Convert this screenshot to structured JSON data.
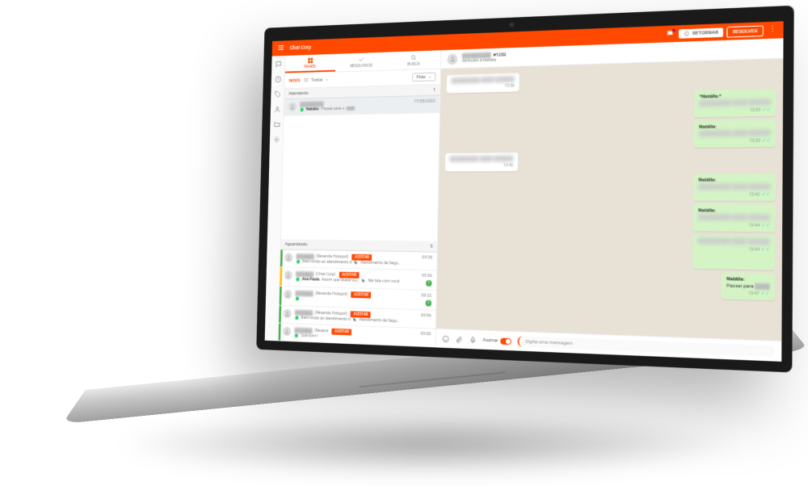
{
  "colors": {
    "accent": "#ff4800",
    "bubble_out": "#d4f4c6",
    "chat_bg": "#e8e1d6"
  },
  "topbar": {
    "title": "Chat Corp",
    "retornar": "RETORNAR",
    "resolver": "RESOLVER"
  },
  "tabs": {
    "inbox": "PAINEL",
    "resolved": "RESOLVIDOS",
    "search": "BUSCA"
  },
  "filters": {
    "novo": "NOVO",
    "todos": "Todos",
    "filas": "Filas"
  },
  "sections": {
    "atendendo": "Atendendo",
    "aguardando": "Aguardando"
  },
  "attending": {
    "count": "1",
    "item": {
      "sender": "Natália:",
      "preview": "Passei para o",
      "time": "17/05/2022"
    }
  },
  "waiting": {
    "count": "5",
    "accept": "ACEITAR",
    "items": [
      {
        "channel": "(Revenda Hotspot)",
        "preview": "Bem-vindo ao atendimento d",
        "tag": "Atendimento de Segu...",
        "time": "09:36",
        "stripe": "#4caf50"
      },
      {
        "channel": "(Chat Corp)",
        "agent": "Ana Paula",
        "preview": "Assim que liberar eu…",
        "tag": "Me fala com você",
        "time": "09:36",
        "badge": "1",
        "stripe": "#ffc107"
      },
      {
        "channel": "(Revenda Hotspot)",
        "preview": "",
        "time": "09:22",
        "badge": "1",
        "stripe": "#4caf50"
      },
      {
        "channel": "(Revenda Hotspot)",
        "preview": "Bem-vindo ao atendimento d",
        "tag": "Atendimento de Segu...",
        "time": "09:06",
        "stripe": "#4caf50"
      },
      {
        "channel": "(Revend",
        "preview": "Que bom?",
        "time": "09:00",
        "stripe": "#4caf50"
      }
    ]
  },
  "chat": {
    "header": {
      "ticket": "#1252",
      "assigned": "Atribuído à Natália"
    },
    "messages": [
      {
        "dir": "in",
        "text_blur": true,
        "time": "13:36"
      },
      {
        "dir": "out",
        "sender": "*Natália:*",
        "text_blur": true,
        "time": "13:39"
      },
      {
        "dir": "out",
        "sender": "Natália:",
        "text_blur": true,
        "time": "13:39"
      },
      {
        "dir": "in",
        "text_blur": true,
        "time": "13:42"
      },
      {
        "dir": "out",
        "sender": "Natália:",
        "text_blur": true,
        "time": "13:42"
      },
      {
        "dir": "out",
        "sender": "Natália:",
        "text_blur": true,
        "time": "13:44"
      },
      {
        "dir": "out",
        "text_blur": true,
        "time": "13:44",
        "tall": true
      },
      {
        "dir": "out",
        "sender": "Natália:",
        "text": "Passei para",
        "time": "13:47"
      }
    ],
    "composer": {
      "sign_label": "Assinar",
      "placeholder": "Digite uma mensagem"
    }
  }
}
